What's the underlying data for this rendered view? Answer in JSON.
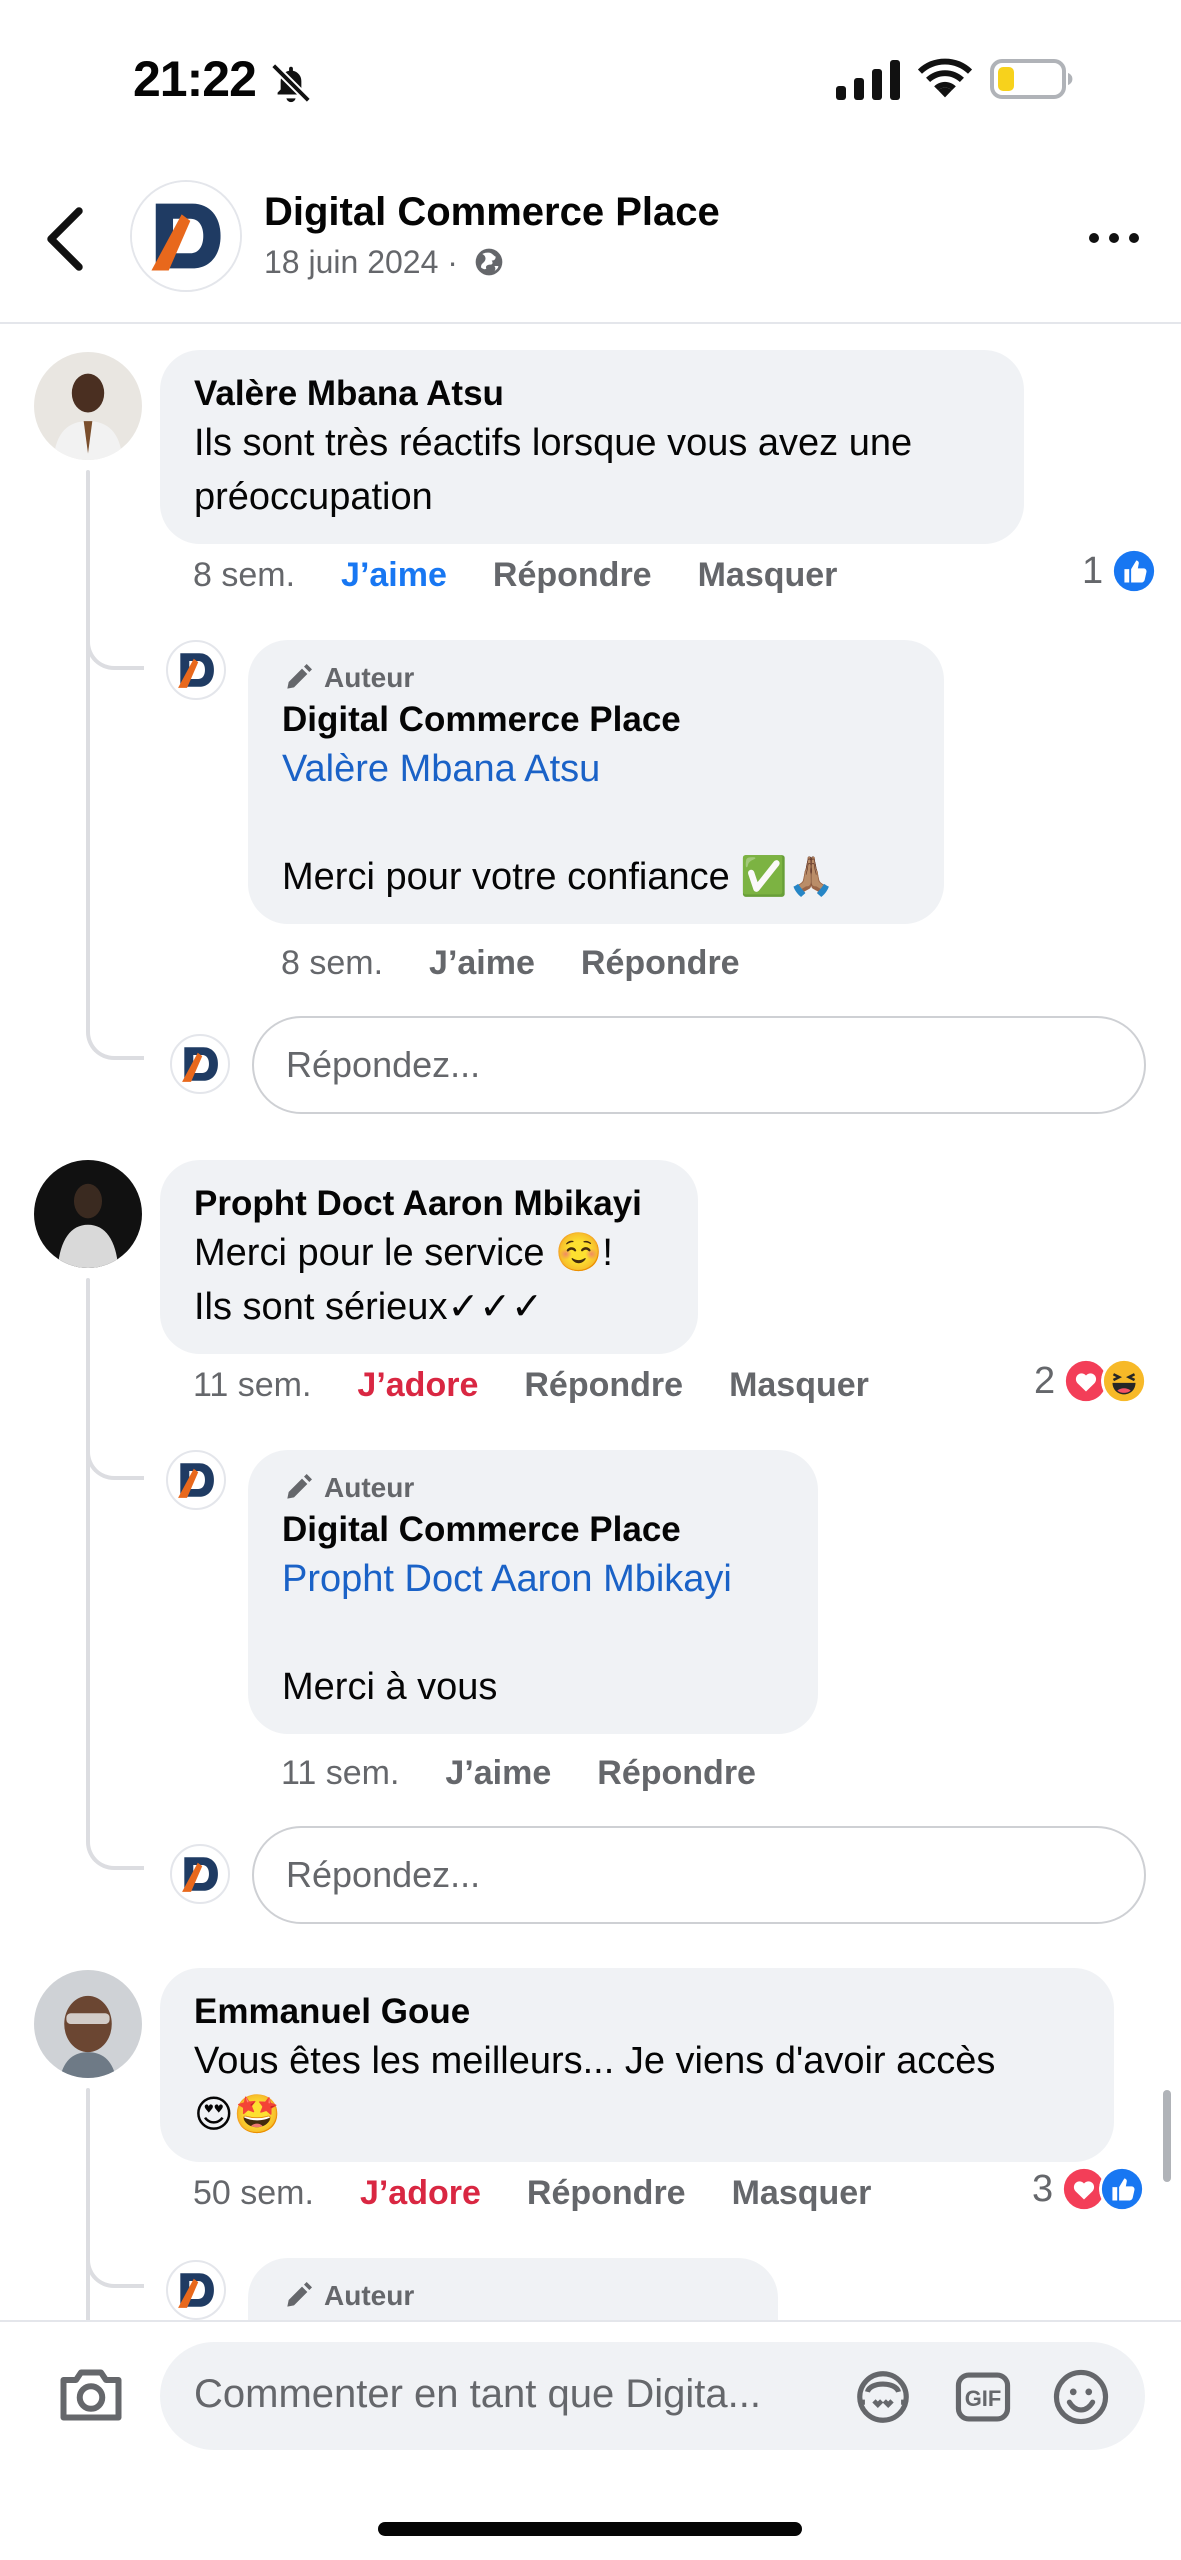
{
  "status_bar": {
    "time": "21:22"
  },
  "header": {
    "title": "Digital Commerce Place",
    "date": "18 juin 2024 ·"
  },
  "comments": [
    {
      "author": "Valère Mbana Atsu",
      "text": "Ils sont très réactifs lorsque vous avez une préoccupation",
      "time": "8 sem.",
      "like_label": "J’aime",
      "reply_label": "Répondre",
      "hide_label": "Masquer",
      "reaction_count": "1",
      "reply": {
        "author_tag": "Auteur",
        "author": "Digital Commerce Place",
        "mention": "Valère Mbana Atsu",
        "text": "Merci pour votre confiance ✅🙏🏽",
        "time": "8 sem.",
        "like_label": "J’aime",
        "reply_label": "Répondre"
      },
      "reply_placeholder": "Répondez..."
    },
    {
      "author": "Propht Doct Aaron Mbikayi",
      "text_line1": "Merci pour le service ☺️!",
      "text_line2": "Ils sont sérieux✓✓✓",
      "time": "11 sem.",
      "like_label": "J’adore",
      "reply_label": "Répondre",
      "hide_label": "Masquer",
      "reaction_count": "2",
      "reply": {
        "author_tag": "Auteur",
        "author": "Digital Commerce Place",
        "mention": "Propht Doct Aaron Mbikayi",
        "text": "Merci à vous",
        "time": "11 sem.",
        "like_label": "J’aime",
        "reply_label": "Répondre"
      },
      "reply_placeholder": "Répondez..."
    },
    {
      "author": "Emmanuel Goue",
      "text_line1": "Vous êtes les meilleurs... Je viens d'avoir accès",
      "text_line2": "😍🤩",
      "time": "50 sem.",
      "like_label": "J’adore",
      "reply_label": "Répondre",
      "hide_label": "Masquer",
      "reaction_count": "3",
      "reply": {
        "author_tag": "Auteur"
      }
    }
  ],
  "composer": {
    "placeholder": "Commenter en tant que Digita..."
  },
  "colors": {
    "accent": "#1877f2",
    "love": "#d92742",
    "mention": "#1a62c7",
    "logo_orange": "#e8681c",
    "logo_navy": "#1f3b63"
  }
}
